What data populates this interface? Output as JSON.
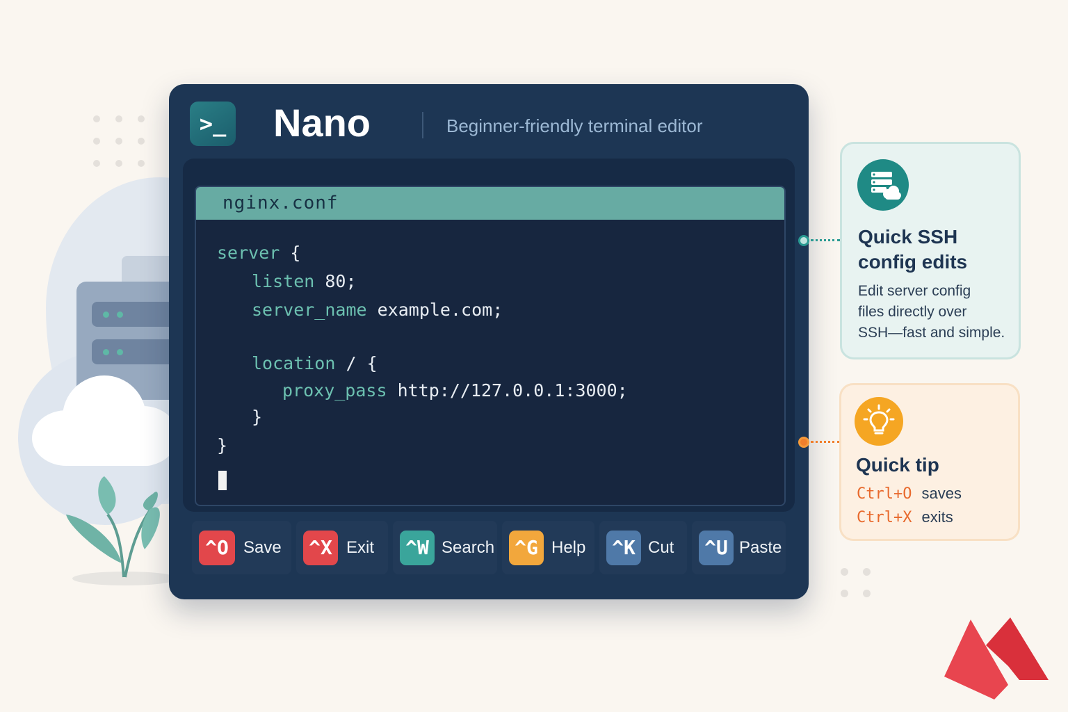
{
  "app": {
    "icon_glyph": ">_",
    "title": "Nano",
    "subtitle": "Beginner-friendly terminal editor"
  },
  "editor": {
    "filename": "nginx.conf",
    "lines": [
      {
        "kw": "server",
        "rest": " {"
      },
      {
        "kw": "listen",
        "rest": " 80;"
      },
      {
        "kw": "server_name",
        "rest": " example.com;"
      },
      {
        "kw": "location",
        "rest": " / {"
      },
      {
        "kw": "proxy_pass",
        "rest": " http://127.0.0.1:3000;"
      },
      {
        "kw": "",
        "rest": "}"
      },
      {
        "kw": "",
        "rest": "}"
      }
    ]
  },
  "shortcuts": [
    {
      "key": "^O",
      "label": "Save",
      "color": "#e2474b"
    },
    {
      "key": "^X",
      "label": "Exit",
      "color": "#e2474b"
    },
    {
      "key": "^W",
      "label": "Search",
      "color": "#3aa59b"
    },
    {
      "key": "^G",
      "label": "Help",
      "color": "#f2a73c"
    },
    {
      "key": "^K",
      "label": "Cut",
      "color": "#4f79a8"
    },
    {
      "key": "^U",
      "label": "Paste",
      "color": "#4f79a8"
    }
  ],
  "cards": {
    "ssh": {
      "icon": "server-cloud-icon",
      "title_line1": "Quick SSH",
      "title_line2": "config edits",
      "body_line1": "Edit server config",
      "body_line2": "files directly over",
      "body_line3": "SSH—fast and simple.",
      "accent": "#2a8f8a"
    },
    "tip": {
      "icon": "lightbulb-icon",
      "title": "Quick tip",
      "items": [
        {
          "keys": "Ctrl+O",
          "action": "saves"
        },
        {
          "keys": "Ctrl+X",
          "action": "exits"
        }
      ],
      "accent": "#f5a623"
    }
  },
  "colors": {
    "window": "#1d3654",
    "keyword": "#6cc0b0",
    "file_tab": "#67aba3",
    "brand_logo": "#e8454f"
  }
}
